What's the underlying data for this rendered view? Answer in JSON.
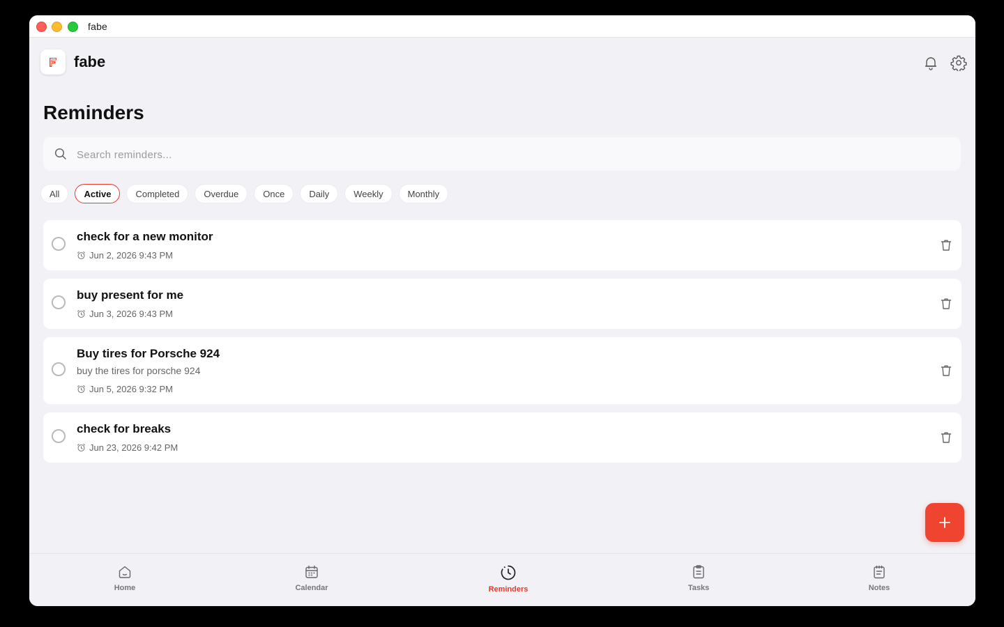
{
  "window": {
    "title": "fabe"
  },
  "header": {
    "app_name": "fabe"
  },
  "page": {
    "title": "Reminders"
  },
  "search": {
    "placeholder": "Search reminders..."
  },
  "filters": [
    {
      "label": "All",
      "selected": false
    },
    {
      "label": "Active",
      "selected": true
    },
    {
      "label": "Completed",
      "selected": false
    },
    {
      "label": "Overdue",
      "selected": false
    },
    {
      "label": "Once",
      "selected": false
    },
    {
      "label": "Daily",
      "selected": false
    },
    {
      "label": "Weekly",
      "selected": false
    },
    {
      "label": "Monthly",
      "selected": false
    }
  ],
  "reminders": [
    {
      "title": "check for a new monitor",
      "description": "",
      "datetime": "Jun 2, 2026 9:43 PM"
    },
    {
      "title": "buy present for me",
      "description": "",
      "datetime": "Jun 3, 2026 9:43 PM"
    },
    {
      "title": "Buy tires for Porsche 924",
      "description": "buy the tires for porsche 924",
      "datetime": "Jun 5, 2026 9:32 PM"
    },
    {
      "title": "check for breaks",
      "description": "",
      "datetime": "Jun 23, 2026 9:42 PM"
    }
  ],
  "nav": [
    {
      "label": "Home",
      "icon": "home-icon",
      "active": false
    },
    {
      "label": "Calendar",
      "icon": "calendar-icon",
      "active": false
    },
    {
      "label": "Reminders",
      "icon": "clock-icon",
      "active": true
    },
    {
      "label": "Tasks",
      "icon": "clipboard-icon",
      "active": false
    },
    {
      "label": "Notes",
      "icon": "notes-icon",
      "active": false
    }
  ],
  "colors": {
    "accent": "#e8392b",
    "fab": "#ef4430",
    "background": "#f2f1f6",
    "card": "#ffffff"
  }
}
